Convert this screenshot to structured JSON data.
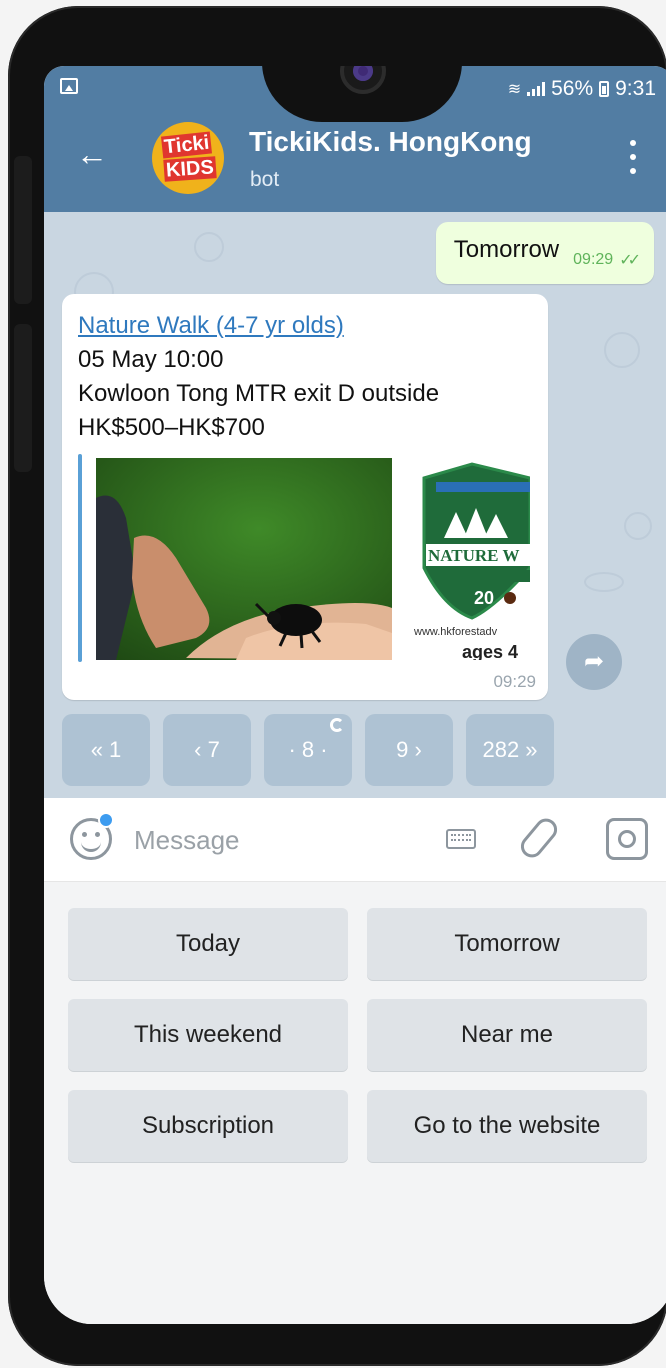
{
  "status": {
    "battery": "56%",
    "time": "9:31"
  },
  "header": {
    "title": "TickiKids. HongKong",
    "subtitle": "bot",
    "avatar_line1": "Ticki",
    "avatar_line2": "KIDS"
  },
  "messages": {
    "outgoing": {
      "text": "Tomorrow",
      "time": "09:29"
    },
    "incoming": {
      "link": "Nature Walk (4-7 yr olds)",
      "date": "05 May 10:00",
      "location": "Kowloon Tong MTR exit D outside",
      "price": "HK$500–HK$700",
      "promo_site": "www.hkforestadv",
      "promo_ages": "ages 4",
      "time": "09:29"
    }
  },
  "pager": [
    {
      "label": "« 1"
    },
    {
      "label": "‹ 7"
    },
    {
      "label": "· 8 ·"
    },
    {
      "label": "9 ›"
    },
    {
      "label": "282 »"
    }
  ],
  "input": {
    "placeholder": "Message"
  },
  "keyboard": {
    "today": "Today",
    "tomorrow": "Tomorrow",
    "this_weekend": "This weekend",
    "near_me": "Near me",
    "subscription": "Subscription",
    "website": "Go to the website"
  },
  "colors": {
    "header": "#527da3",
    "chat_bg": "#c9d6e1",
    "outgoing_bubble": "#efffde",
    "link": "#2f79be"
  }
}
